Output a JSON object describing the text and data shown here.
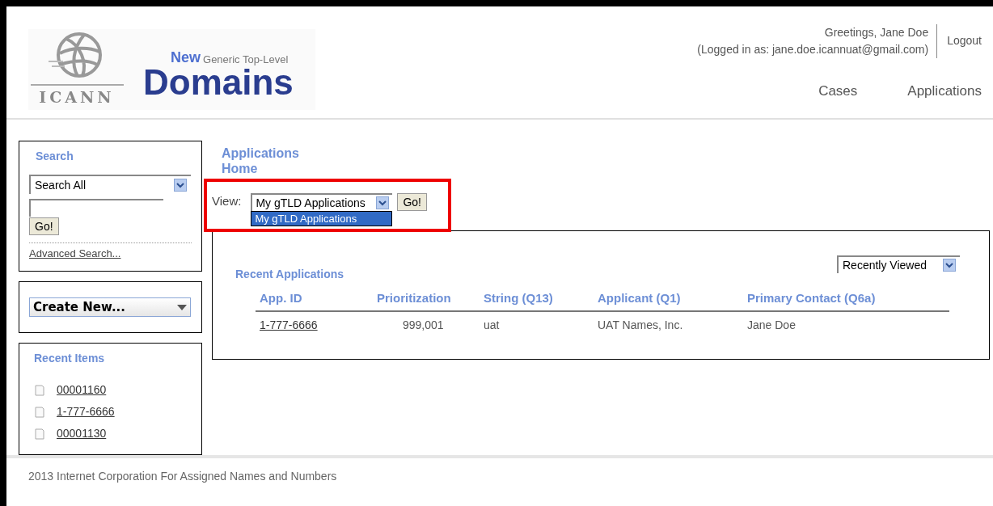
{
  "header": {
    "logo": {
      "org": "ICANN",
      "new": "New",
      "tagline": "Generic Top-Level",
      "title": "Domains"
    },
    "greeting": "Greetings, Jane Doe",
    "logged_in_as": "(Logged in as: jane.doe.icannuat@gmail.com)",
    "logout": "Logout",
    "nav": [
      {
        "label": "Cases"
      },
      {
        "label": "Applications"
      }
    ]
  },
  "sidebar": {
    "search": {
      "title": "Search",
      "scope": "Search All",
      "button": "Go!",
      "advanced_link": "Advanced Search..."
    },
    "create_new": "Create New...",
    "recent_items": {
      "title": "Recent Items",
      "items": [
        "00001160",
        "1-777-6666",
        "00001130"
      ]
    }
  },
  "main": {
    "title_lines": [
      "Applications",
      "Home"
    ],
    "view": {
      "label": "View:",
      "value": "My gTLD Applications",
      "button": "Go!",
      "options": [
        {
          "label": "My gTLD Applications",
          "selected": true
        }
      ]
    },
    "recent_applications": {
      "title": "Recent Applications",
      "sort": "Recently Viewed",
      "columns": [
        "App. ID",
        "Prioritization",
        "String (Q13)",
        "Applicant (Q1)",
        "Primary Contact (Q6a)"
      ],
      "rows": [
        [
          "1-777-6666",
          "999,001",
          "uat",
          "UAT Names, Inc.",
          "Jane Doe"
        ]
      ]
    }
  },
  "footer": "2013 Internet Corporation For Assigned Names and Numbers"
}
